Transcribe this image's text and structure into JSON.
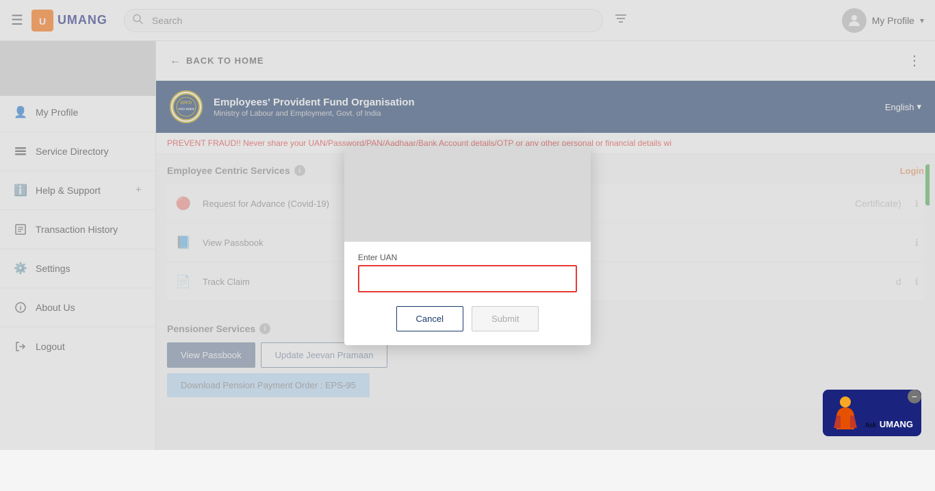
{
  "header": {
    "menu_icon": "☰",
    "logo_text": "UMANG",
    "logo_icon_text": "U",
    "search_placeholder": "Search",
    "profile_label": "My Profile",
    "profile_chevron": "▾"
  },
  "sidebar": {
    "items": [
      {
        "id": "my-profile",
        "label": "My Profile",
        "icon": "👤",
        "plus": false
      },
      {
        "id": "service-directory",
        "label": "Service Directory",
        "icon": "📋",
        "plus": false
      },
      {
        "id": "help-support",
        "label": "Help & Support",
        "icon": "ℹ️",
        "plus": true
      },
      {
        "id": "transaction-history",
        "label": "Transaction History",
        "icon": "🗒️",
        "plus": false
      },
      {
        "id": "settings",
        "label": "Settings",
        "icon": "⚙️",
        "plus": false
      },
      {
        "id": "about-us",
        "label": "About Us",
        "icon": "ℹ️",
        "plus": false
      },
      {
        "id": "logout",
        "label": "Logout",
        "icon": "🔓",
        "plus": false
      }
    ]
  },
  "back_bar": {
    "label": "BACK TO HOME",
    "more_icon": "⋮"
  },
  "epfo": {
    "title": "Employees' Provident Fund Organisation",
    "subtitle": "Ministry of Labour and Employment, Govt. of India",
    "lang_label": "English",
    "lang_chevron": "▾",
    "fraud_warning": "PREVENT FRAUD!! Never share your UAN/Password/PAN/Aadhaar/Bank Account details/OTP or any other personal or financial details wi",
    "login_label": "Login"
  },
  "employee_services": {
    "section_title": "Employee Centric Services",
    "services": [
      {
        "id": "request-advance",
        "label": "Request for Advance (Covid-19)",
        "icon": "🔴",
        "has_info": true,
        "right_text": "Certificate)"
      },
      {
        "id": "view-passbook",
        "label": "View Passbook",
        "icon": "📘",
        "has_info": true,
        "right_text": ""
      },
      {
        "id": "track-claim",
        "label": "Track Claim",
        "icon": "📄",
        "has_info": true,
        "right_text": "d"
      }
    ]
  },
  "pensioner_services": {
    "section_title": "Pensioner Services",
    "buttons": [
      {
        "id": "view-passbook-btn",
        "label": "View Passbook",
        "style": "dark"
      },
      {
        "id": "update-jeevan-btn",
        "label": "Update Jeevan Pramaan",
        "style": "outline"
      },
      {
        "id": "download-pension-btn",
        "label": "Download Pension Payment Order : EPS-95",
        "style": "light"
      }
    ]
  },
  "modal": {
    "field_label": "Enter UAN",
    "input_placeholder": "",
    "cancel_label": "Cancel",
    "submit_label": "Submit"
  },
  "ask_umang": {
    "ask_label": "Ask",
    "umang_label": "UMANG",
    "minus": "−"
  }
}
